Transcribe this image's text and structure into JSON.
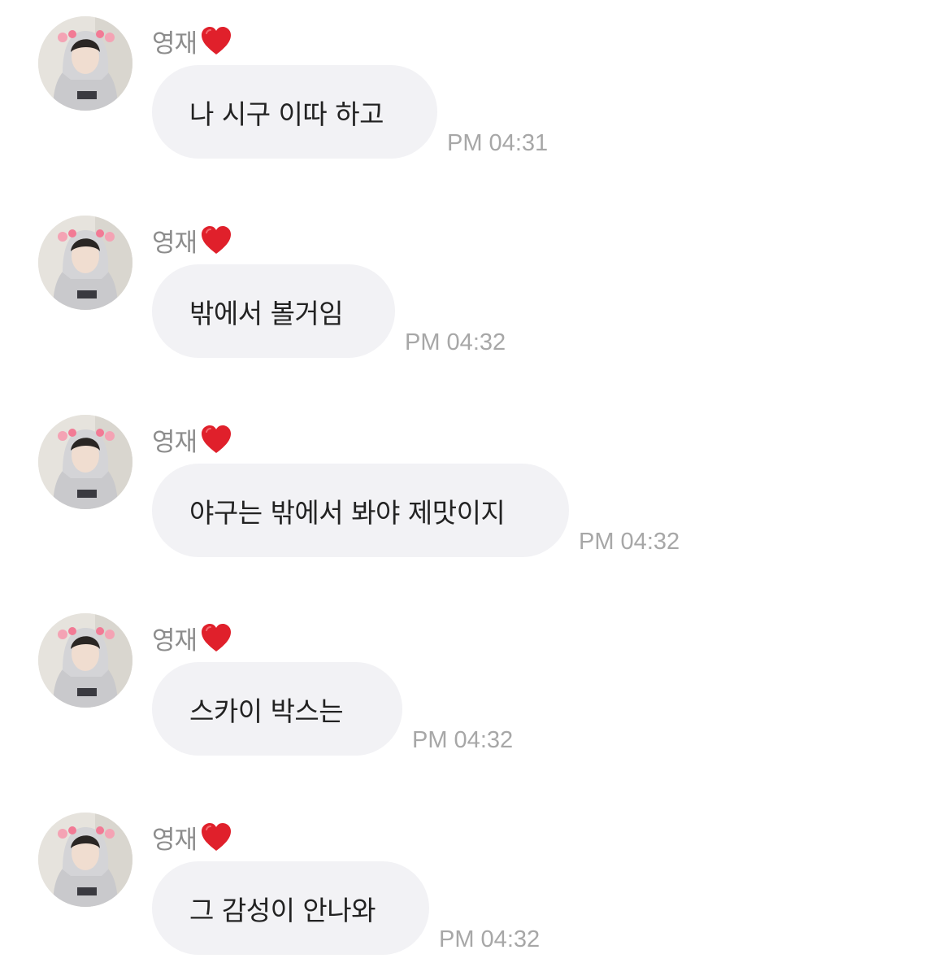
{
  "messages": [
    {
      "sender": "영재",
      "sender_badge": "heart-icon",
      "text": "나 시구 이따 하고",
      "time": "PM 04:31"
    },
    {
      "sender": "영재",
      "sender_badge": "heart-icon",
      "text": "밖에서 볼거임",
      "time": "PM 04:32"
    },
    {
      "sender": "영재",
      "sender_badge": "heart-icon",
      "text": "야구는 밖에서 봐야 제맛이지",
      "time": "PM 04:32"
    },
    {
      "sender": "영재",
      "sender_badge": "heart-icon",
      "text": "스카이 박스는",
      "time": "PM 04:32"
    },
    {
      "sender": "영재",
      "sender_badge": "heart-icon",
      "text": "그 감성이 안나와",
      "time": "PM 04:32"
    }
  ],
  "colors": {
    "bubble": "#f2f2f5",
    "text": "#222222",
    "sender": "#8c8c8c",
    "timestamp": "#a7a7a7",
    "heart": "#e0202b"
  }
}
